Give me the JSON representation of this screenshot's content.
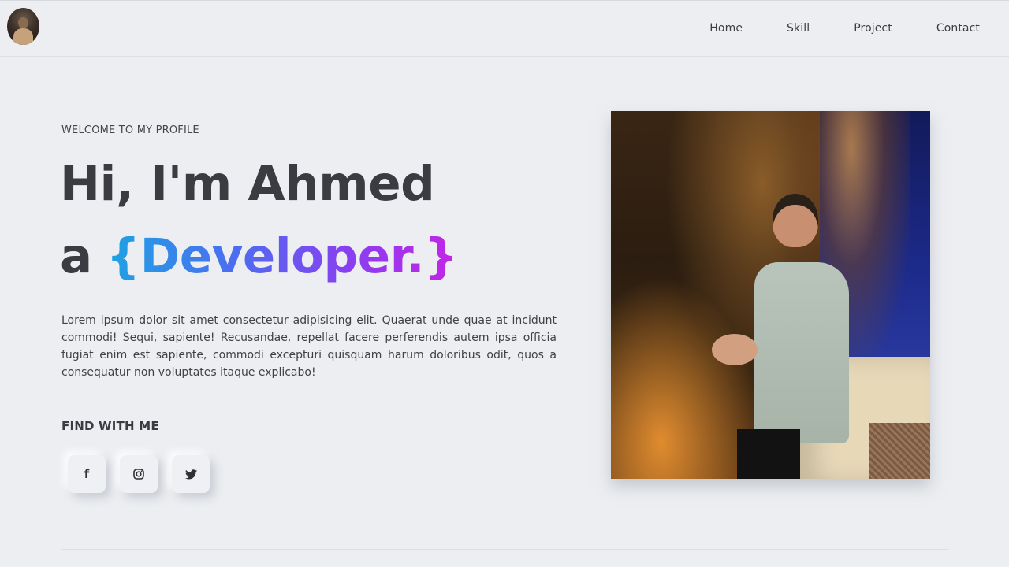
{
  "header": {
    "nav": [
      {
        "label": "Home"
      },
      {
        "label": "Skill"
      },
      {
        "label": "Project"
      },
      {
        "label": "Contact"
      }
    ]
  },
  "hero": {
    "welcome": "WELCOME TO MY PROFILE",
    "greeting": "Hi, I'm Ahmed",
    "prefix": "a",
    "role": "{Developer.}",
    "description": "Lorem ipsum dolor sit amet consectetur adipisicing elit. Quaerat unde quae at incidunt commodi! Sequi, sapiente! Recusandae, repellat facere perferendis autem ipsa officia fugiat enim est sapiente, commodi excepturi quisquam harum doloribus odit, quos a consequatur non voluptates itaque explicabo!",
    "role_gradient": [
      "#1ea3e3",
      "#4a6ff0",
      "#8b3ef0",
      "#c524e6"
    ]
  },
  "social": {
    "title": "FIND WITH ME",
    "items": [
      {
        "icon": "facebook-icon",
        "glyph": "f"
      },
      {
        "icon": "instagram-icon"
      },
      {
        "icon": "twitter-icon"
      }
    ]
  },
  "colors": {
    "background": "#eceef1",
    "text": "#3a3c41"
  }
}
